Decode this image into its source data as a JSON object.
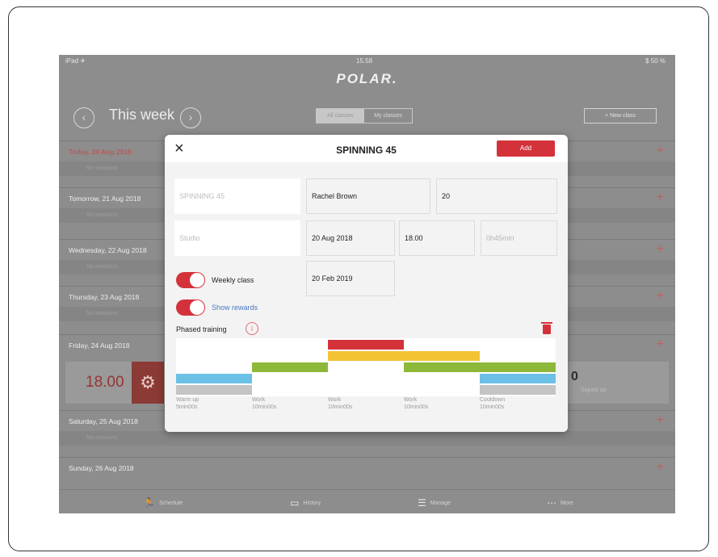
{
  "status": {
    "left": "iPad ✈",
    "time": "15.58",
    "right": "$ 50 %"
  },
  "logo": "POLAR.",
  "week": {
    "title": "This week",
    "prev_icon": "chevron-left-icon",
    "next_icon": "chevron-right-icon"
  },
  "segment": {
    "all": "All classes",
    "mine": "My classes"
  },
  "new_class": "+ New class",
  "days": [
    {
      "label": "Today, 20 Aug 2018",
      "sub": "No sessions"
    },
    {
      "label": "Tomorrow, 21 Aug 2018",
      "sub": "No sessions"
    },
    {
      "label": "Wednesday, 22 Aug 2018",
      "sub": "No sessions"
    },
    {
      "label": "Thursday, 23 Aug 2018",
      "sub": "No sessions"
    },
    {
      "label": "Friday, 24 Aug 2018",
      "sub": ""
    },
    {
      "label": "Saturday, 25 Aug 2018",
      "sub": "No sessions"
    },
    {
      "label": "Sunday, 26 Aug 2018",
      "sub": ""
    }
  ],
  "plus": "+",
  "friday_card": {
    "time": "18.00",
    "count": "0",
    "signed": "Signed up"
  },
  "tabs": [
    {
      "label": "Schedule",
      "icon": "runner-icon"
    },
    {
      "label": "History",
      "icon": "calendar-icon"
    },
    {
      "label": "Manage",
      "icon": "list-icon"
    },
    {
      "label": "More",
      "icon": "more-icon"
    }
  ],
  "modal": {
    "close": "×",
    "title": "SPINNING 45",
    "add": "Add",
    "name_placeholder": "SPINNING 45",
    "instructor": "Rachel Brown",
    "capacity": "20",
    "location_placeholder": "Studio",
    "date": "20 Aug 2018",
    "time": "18.00",
    "duration": "0h45min",
    "weekly_label": "Weekly class",
    "weekly_end": "20 Feb 2019",
    "rewards_label": "Show rewards",
    "phased_label": "Phased training",
    "info": "i",
    "phases": [
      {
        "name": "Warm up",
        "dur": "5min00s"
      },
      {
        "name": "Work",
        "dur": "10min00s"
      },
      {
        "name": "Work",
        "dur": "10min00s"
      },
      {
        "name": "Work",
        "dur": "10min00s"
      },
      {
        "name": "Cooldown",
        "dur": "10min00s"
      }
    ]
  },
  "colors": {
    "accent": "#d4323b",
    "zone_red": "#d4323b",
    "zone_yellow": "#f3c335",
    "zone_green": "#8db83a",
    "zone_blue": "#6bc0e6",
    "zone_gray": "#c4c4c4"
  }
}
